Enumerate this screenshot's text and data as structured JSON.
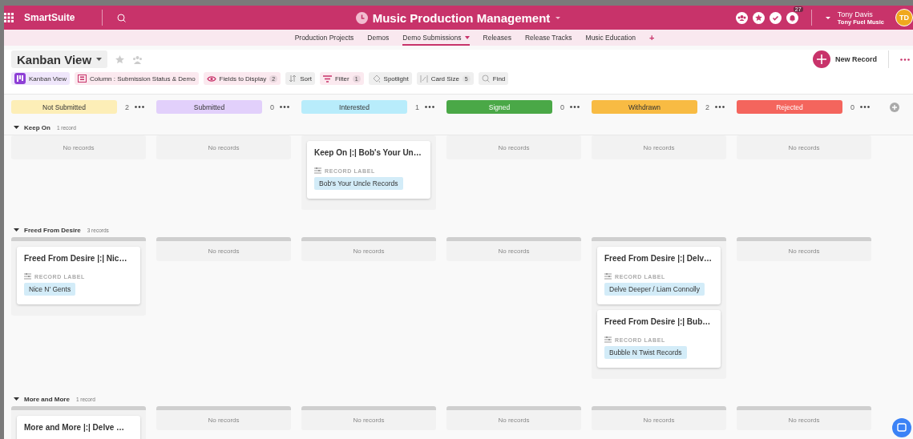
{
  "app": {
    "logo": "SmartSuite",
    "title": "Music Production Management",
    "notifications": "27",
    "user": {
      "name": "Tony Davis",
      "org": "Tony Fuel Music",
      "initials": "TD"
    }
  },
  "tabs": [
    {
      "label": "Production Projects",
      "selected": false
    },
    {
      "label": "Demos",
      "selected": false
    },
    {
      "label": "Demo Submissions",
      "selected": true
    },
    {
      "label": "Releases",
      "selected": false
    },
    {
      "label": "Release Tracks",
      "selected": false
    },
    {
      "label": "Music Education",
      "selected": false
    },
    {
      "label": "+",
      "selected": false
    }
  ],
  "view": {
    "name": "Kanban View",
    "new_record": "New Record"
  },
  "toolbar": [
    {
      "kind": "kanban",
      "label": "Kanban View",
      "active": true
    },
    {
      "kind": "column",
      "label": "Column : Submission Status & Demo",
      "active": true
    },
    {
      "kind": "eye",
      "label": "Fields to Display",
      "badge": "2",
      "active": true
    },
    {
      "kind": "sort",
      "label": "Sort",
      "active": false
    },
    {
      "kind": "filter",
      "label": "Filter",
      "badge": "1",
      "active": true
    },
    {
      "kind": "spotlight",
      "label": "Spotlight",
      "active": false
    },
    {
      "kind": "cardsize",
      "label": "Card Size",
      "badge": "5",
      "active": false
    },
    {
      "kind": "find",
      "label": "Find",
      "active": false
    }
  ],
  "columns": [
    {
      "name": "Not Submitted",
      "count": "2",
      "color": "#fdeeb7"
    },
    {
      "name": "Submitted",
      "count": "0",
      "color": "#e2d0fb"
    },
    {
      "name": "Interested",
      "count": "1",
      "color": "#b8ecfb"
    },
    {
      "name": "Signed",
      "count": "0",
      "color": "#4aa847"
    },
    {
      "name": "Withdrawn",
      "count": "2",
      "color": "#f8bb43"
    },
    {
      "name": "Rejected",
      "count": "0",
      "color": "#f4655d"
    }
  ],
  "groups": [
    {
      "name": "Keep On",
      "count": "1 record",
      "expanded": true,
      "lanes": [
        {
          "empty_text": "No records"
        },
        {
          "empty_text": "No records"
        },
        {
          "cards": [
            {
              "title": "Keep On |:| Bob's Your Un…",
              "field_label": "RECORD LABEL",
              "tag": "Bob's Your Uncle Records"
            }
          ]
        },
        {
          "empty_text": "No records"
        },
        {
          "empty_text": "No records"
        },
        {
          "empty_text": "No records"
        }
      ]
    },
    {
      "name": "Freed From Desire",
      "count": "3 records",
      "expanded": true,
      "lanes": [
        {
          "cards": [
            {
              "title": "Freed From Desire |:| Nic…",
              "field_label": "RECORD LABEL",
              "tag": "Nice N' Gents"
            }
          ]
        },
        {
          "empty_text": "No records"
        },
        {
          "empty_text": "No records"
        },
        {
          "empty_text": "No records"
        },
        {
          "cards": [
            {
              "title": "Freed From Desire |:| Delv…",
              "field_label": "RECORD LABEL",
              "tag": "Delve Deeper / Liam Connolly"
            },
            {
              "title": "Freed From Desire |:| Bub…",
              "field_label": "RECORD LABEL",
              "tag": "Bubble N Twist Records"
            }
          ]
        },
        {
          "empty_text": "No records"
        }
      ]
    },
    {
      "name": "More and More",
      "count": "1 record",
      "expanded": true,
      "lanes": [
        {
          "cards": [
            {
              "title": "More and More |:| Delve …"
            }
          ]
        },
        {
          "empty_text": "No records"
        },
        {
          "empty_text": "No records"
        },
        {
          "empty_text": "No records"
        },
        {
          "empty_text": "No records"
        },
        {
          "empty_text": "No records"
        }
      ]
    }
  ]
}
